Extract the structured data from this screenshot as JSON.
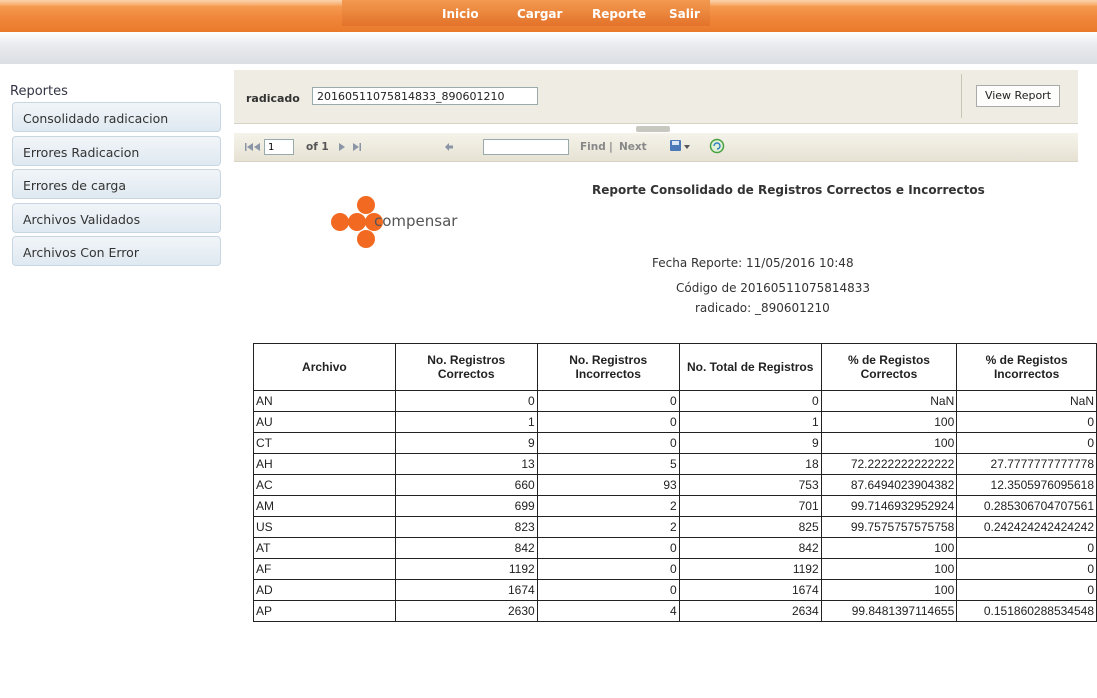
{
  "nav": {
    "items": [
      "Inicio",
      "Cargar",
      "Reporte",
      "Salir"
    ]
  },
  "sidebar": {
    "title": "Reportes",
    "items": [
      "Consolidado radicacion",
      "Errores Radicacion",
      "Errores de carga",
      "Archivos Validados",
      "Archivos Con Error"
    ]
  },
  "params": {
    "label": "radicado",
    "value": "20160511075814833_890601210",
    "view_button": "View Report"
  },
  "toolbar": {
    "first_icon": "first-page-icon",
    "prev_icon": "prev-page-icon",
    "page_value": "1",
    "of_text": "of 1",
    "next_icon": "next-page-icon",
    "last_icon": "last-page-icon",
    "back_icon": "back-icon",
    "find_label": "Find",
    "separator": "|",
    "next_label": "Next",
    "export_icon": "export-icon",
    "refresh_icon": "refresh-icon"
  },
  "report": {
    "title": "Reporte Consolidado de Registros Correctos e Incorrectos",
    "logo_text": "compensar",
    "fecha": "Fecha Reporte: 11/05/2016 10:48",
    "codigo_line1": "Código de 20160511075814833",
    "codigo_line2": "radicado: _890601210",
    "headers": [
      "Archivo",
      "No. Registros Correctos",
      "No. Registros Incorrectos",
      "No. Total de Registros",
      "% de Registos Correctos",
      "% de Registos Incorrectos"
    ],
    "rows": [
      [
        "AN",
        "0",
        "0",
        "0",
        "NaN",
        "NaN"
      ],
      [
        "AU",
        "1",
        "0",
        "1",
        "100",
        "0"
      ],
      [
        "CT",
        "9",
        "0",
        "9",
        "100",
        "0"
      ],
      [
        "AH",
        "13",
        "5",
        "18",
        "72.2222222222222",
        "27.7777777777778"
      ],
      [
        "AC",
        "660",
        "93",
        "753",
        "87.6494023904382",
        "12.3505976095618"
      ],
      [
        "AM",
        "699",
        "2",
        "701",
        "99.7146932952924",
        "0.285306704707561"
      ],
      [
        "US",
        "823",
        "2",
        "825",
        "99.7575757575758",
        "0.242424242424242"
      ],
      [
        "AT",
        "842",
        "0",
        "842",
        "100",
        "0"
      ],
      [
        "AF",
        "1192",
        "0",
        "1192",
        "100",
        "0"
      ],
      [
        "AD",
        "1674",
        "0",
        "1674",
        "100",
        "0"
      ],
      [
        "AP",
        "2630",
        "4",
        "2634",
        "99.8481397114655",
        "0.151860288534548"
      ]
    ]
  },
  "colors": {
    "nav_orange": "#f0873a",
    "logo_orange": "#f26a21"
  }
}
